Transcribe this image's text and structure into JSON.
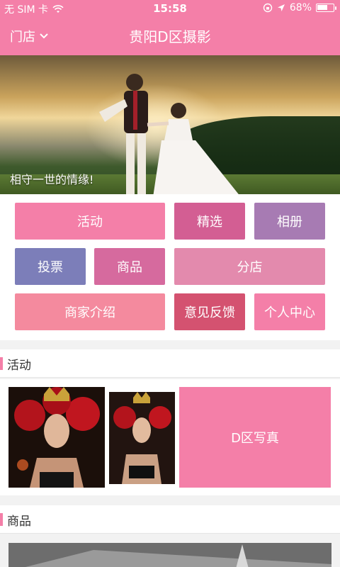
{
  "status": {
    "carrier": "无 SIM 卡",
    "time": "15:58",
    "battery": "68%",
    "battery_level": 0.68
  },
  "nav": {
    "store_label": "门店",
    "title": "贵阳D区摄影"
  },
  "banner": {
    "caption": "相守一世的情缘!"
  },
  "menu": {
    "items": [
      {
        "label": "活动",
        "color": "#f47fa8"
      },
      {
        "label": "精选",
        "color": "#d35e93"
      },
      {
        "label": "相册",
        "color": "#a77bb3"
      },
      {
        "label": "投票",
        "color": "#7c7eb9"
      },
      {
        "label": "商品",
        "color": "#d66a9e"
      },
      {
        "label": "分店",
        "color": "#e38aad"
      },
      {
        "label": "商家介绍",
        "color": "#f48a9e"
      },
      {
        "label": "意见反馈",
        "color": "#d45270"
      },
      {
        "label": "个人中心",
        "color": "#f47fa8"
      }
    ]
  },
  "sections": {
    "activity": {
      "label": "活动",
      "promo_label": "D区写真"
    },
    "products": {
      "label": "商品"
    }
  },
  "colors": {
    "accent": "#f47fa8"
  }
}
